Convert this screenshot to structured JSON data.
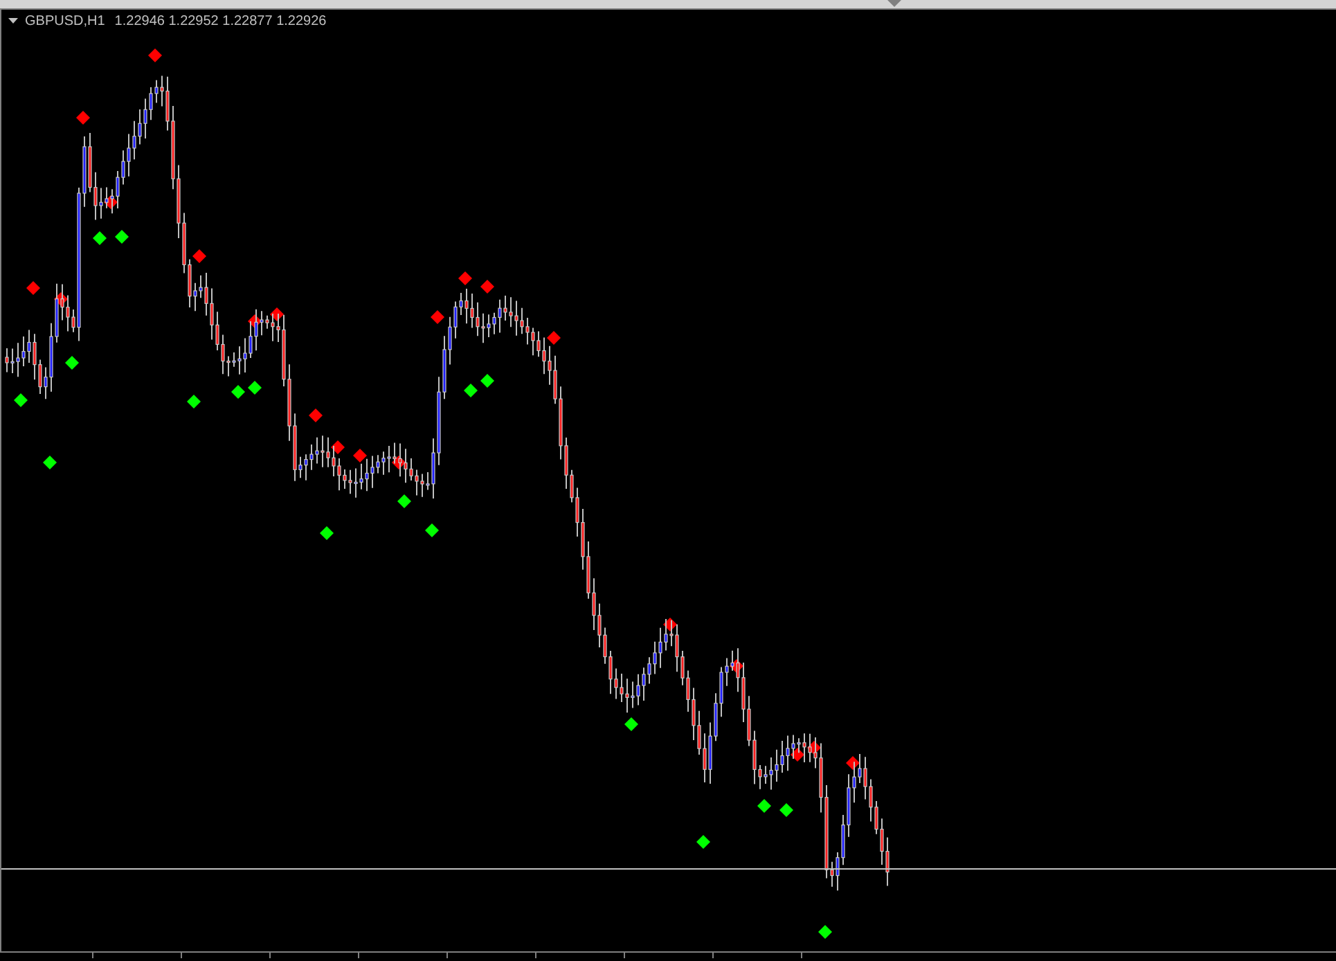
{
  "chart": {
    "symbol": "GBPUSD,H1",
    "quote": "1.22946 1.22952 1.22877 1.22926"
  }
}
